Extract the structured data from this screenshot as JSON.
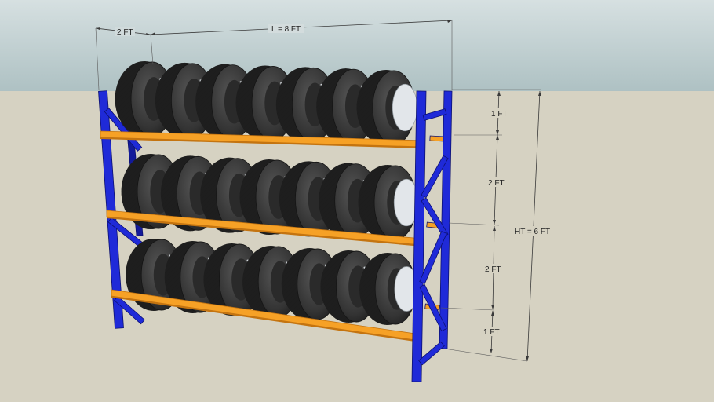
{
  "dimensions": {
    "depth_label": "2 FT",
    "length_label": "L = 8 FT",
    "top_gap_label": "1 FT",
    "upper_gap_label": "2 FT",
    "lower_gap_label": "2 FT",
    "bottom_gap_label": "1 FT",
    "height_label": "HT = 6 FT"
  },
  "rack": {
    "levels": 3,
    "tires_per_level": 7
  },
  "colors": {
    "sky": "#b7c7c9",
    "ground": "#d6d2c2",
    "frame": "#1f2ad8",
    "frame_dark": "#131a9a",
    "beam": "#f6a126",
    "beam_dark": "#c47410",
    "tire": "#3a3a3a",
    "tire_dark": "#1e1e1e",
    "rim": "#e2e6ea"
  }
}
